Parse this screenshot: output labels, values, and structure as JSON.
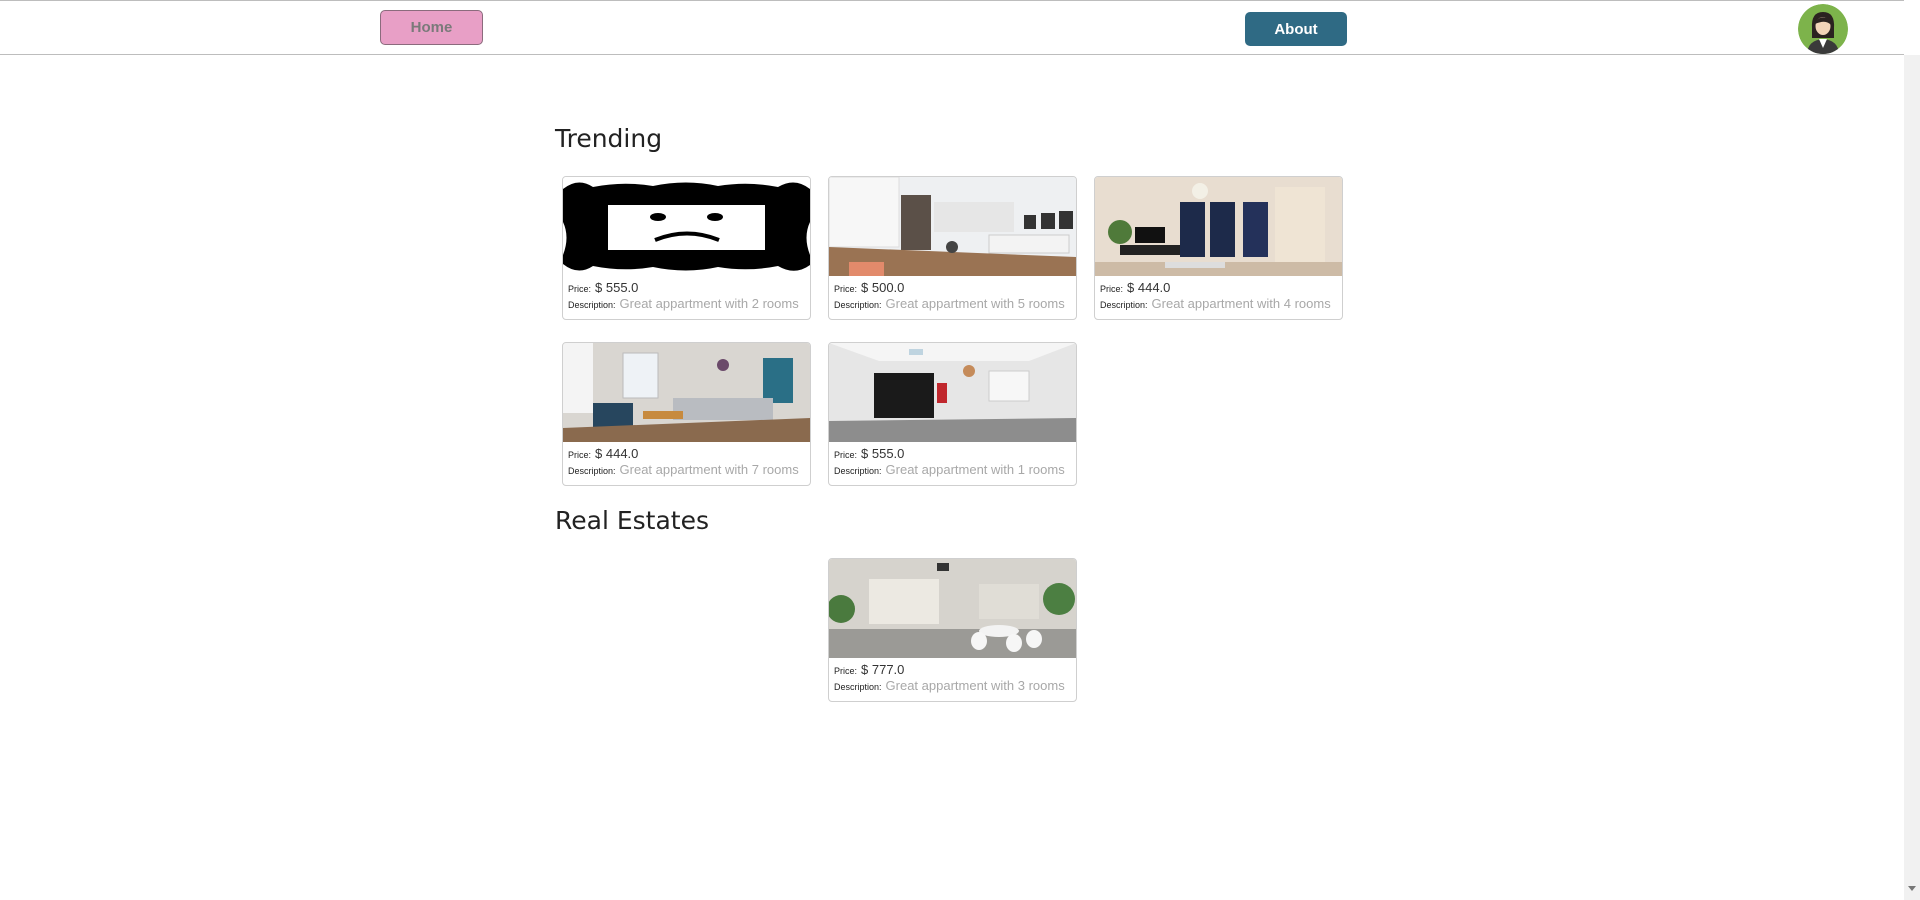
{
  "nav": {
    "home_label": "Home",
    "about_label": "About",
    "colors": {
      "home_bg": "#e89fc6",
      "about_bg": "#2f6a84"
    }
  },
  "sections": {
    "trending_title": "Trending",
    "real_estates_title": "Real Estates"
  },
  "labels": {
    "price": "Price:",
    "description": "Description:"
  },
  "trending": [
    {
      "price": "$ 555.0",
      "description": "Great appartment with 2 rooms",
      "image": "broken-image-sad-face"
    },
    {
      "price": "$ 500.0",
      "description": "Great appartment with 5 rooms",
      "image": "bright-open-living-kitchen"
    },
    {
      "price": "$ 444.0",
      "description": "Great appartment with 4 rooms",
      "image": "beige-living-room-night-view"
    },
    {
      "price": "$ 444.0",
      "description": "Great appartment with 7 rooms",
      "image": "living-room-wood-floor"
    },
    {
      "price": "$ 555.0",
      "description": "Great appartment with 1 rooms",
      "image": "empty-room-black-kitchen"
    }
  ],
  "real_estates": [
    {
      "price": "$ 777.0",
      "description": "Great appartment with 3 rooms",
      "image": "dining-room-white-chairs"
    }
  ]
}
